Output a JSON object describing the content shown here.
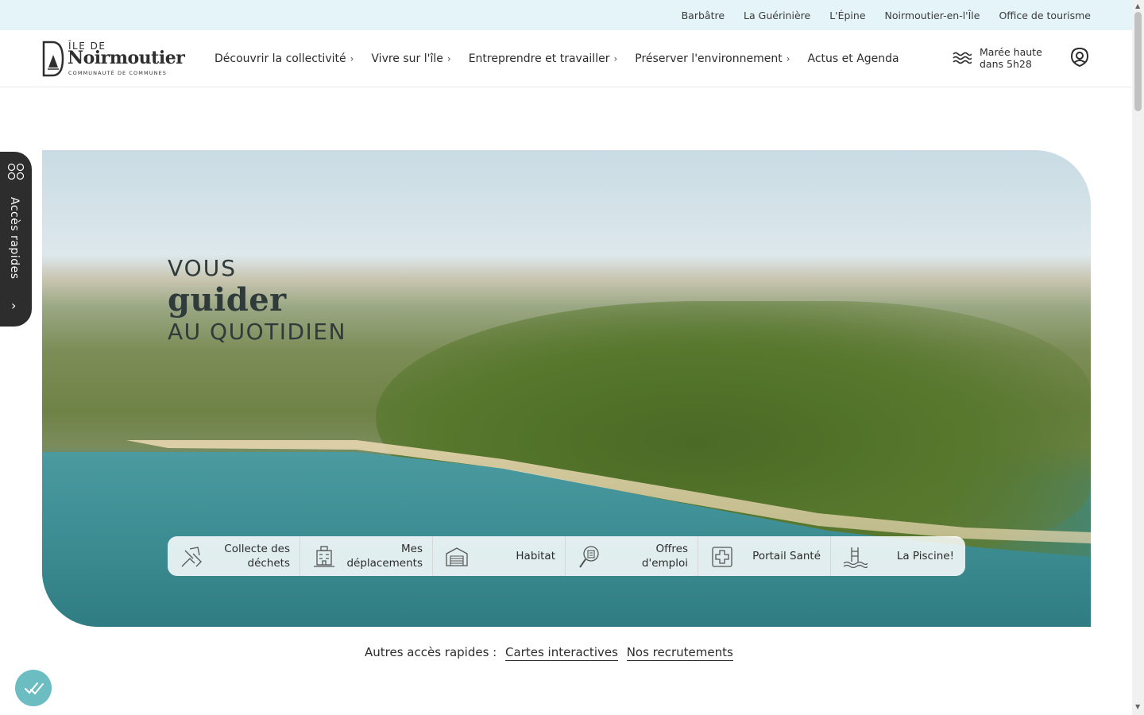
{
  "topbar": {
    "links": [
      "Barbâtre",
      "La Guérinière",
      "L'Épine",
      "Noirmoutier-en-l'Île",
      "Office de tourisme"
    ]
  },
  "logo": {
    "small": "ÎLE DE",
    "big": "Noirmoutier",
    "sub": "COMMUNAUTÉ DE COMMUNES"
  },
  "nav": {
    "items": [
      {
        "label": "Découvrir la collectivité",
        "chevron": "›"
      },
      {
        "label": "Vivre sur l'île",
        "chevron": "›"
      },
      {
        "label": "Entreprendre et travailler",
        "chevron": "›"
      },
      {
        "label": "Préserver l'environnement",
        "chevron": "›"
      },
      {
        "label": "Actus et Agenda",
        "chevron": ""
      }
    ]
  },
  "tide": {
    "line1": "Marée haute",
    "line2": "dans 5h28",
    "icon": "waves-icon"
  },
  "account": {
    "icon": "user-icon"
  },
  "side_tab": {
    "label": "Accès rapides",
    "icon": "grid-icon",
    "chevron": "›"
  },
  "hero": {
    "line1": "VOUS",
    "line2": "guider",
    "line3": "AU QUOTIDIEN"
  },
  "quick_access": [
    {
      "label": "Collecte des déchets",
      "icon": "recycle-hand-icon"
    },
    {
      "label": "Mes déplacements",
      "icon": "bus-icon"
    },
    {
      "label": "Habitat",
      "icon": "house-icon"
    },
    {
      "label": "Offres d'emploi",
      "icon": "job-search-icon"
    },
    {
      "label": "Portail Santé",
      "icon": "health-cross-icon"
    },
    {
      "label": "La Piscine!",
      "icon": "pool-icon"
    }
  ],
  "others": {
    "prefix": "Autres accès rapides :",
    "links": [
      "Cartes interactives",
      "Nos recrutements"
    ]
  },
  "cookie": {
    "icon": "cookie-settings-icon"
  },
  "colors": {
    "topbar_bg": "#e4f4f8",
    "side_tab_bg": "#2d2d2d",
    "cookie_bg": "#6bbdc2"
  }
}
